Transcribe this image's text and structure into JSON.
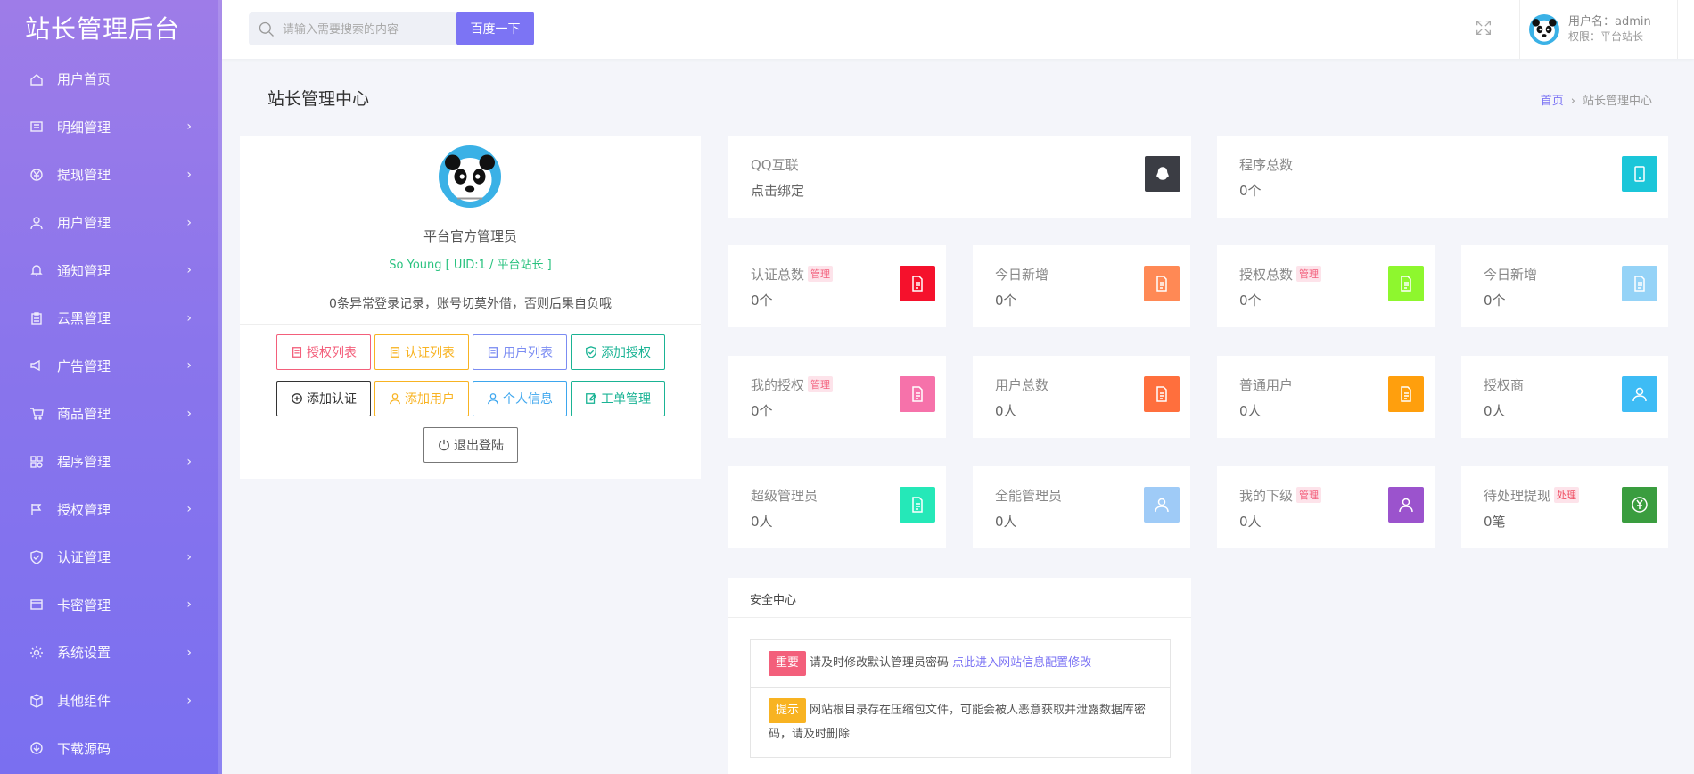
{
  "brand": "站长管理后台",
  "nav": [
    {
      "label": "用户首页",
      "icon": "home-icon",
      "chev": false
    },
    {
      "label": "明细管理",
      "icon": "list-icon",
      "chev": true
    },
    {
      "label": "提现管理",
      "icon": "yen-icon",
      "chev": true
    },
    {
      "label": "用户管理",
      "icon": "user-icon",
      "chev": true
    },
    {
      "label": "通知管理",
      "icon": "bell-icon",
      "chev": true
    },
    {
      "label": "云黑管理",
      "icon": "clipboard-icon",
      "chev": true
    },
    {
      "label": "广告管理",
      "icon": "megaphone-icon",
      "chev": true
    },
    {
      "label": "商品管理",
      "icon": "cart-icon",
      "chev": true
    },
    {
      "label": "程序管理",
      "icon": "apps-icon",
      "chev": true
    },
    {
      "label": "授权管理",
      "icon": "flag-icon",
      "chev": true
    },
    {
      "label": "认证管理",
      "icon": "shield-icon",
      "chev": true
    },
    {
      "label": "卡密管理",
      "icon": "card-icon",
      "chev": true
    },
    {
      "label": "系统设置",
      "icon": "gear-icon",
      "chev": true
    },
    {
      "label": "其他组件",
      "icon": "box-icon",
      "chev": true
    },
    {
      "label": "下载源码",
      "icon": "download-icon",
      "chev": false
    }
  ],
  "chev": "›",
  "search": {
    "placeholder": "请输入需要搜索的内容",
    "button": "百度一下"
  },
  "user": {
    "name": "用户名：admin",
    "role": "权限：平台站长"
  },
  "page_title": "站长管理中心",
  "breadcrumb": {
    "home": "首页",
    "sep": "›",
    "current": "站长管理中心"
  },
  "profile": {
    "name": "平台官方管理员",
    "uid": "So Young [ UID:1 / 平台站长 ]",
    "notice": "0条异常登录记录，账号切莫外借，否则后果自负哦",
    "buttons_row1": [
      "授权列表",
      "认证列表",
      "用户列表",
      "添加授权"
    ],
    "buttons_row2": [
      "添加认证",
      "添加用户",
      "个人信息",
      "工单管理"
    ],
    "logout": "退出登陆"
  },
  "stats": {
    "qq": {
      "title": "QQ互联",
      "value": "点击绑定"
    },
    "programs": {
      "title": "程序总数",
      "value": "0个"
    },
    "certs": {
      "title": "认证总数",
      "badge": "管理",
      "value": "0个"
    },
    "today_new_a": {
      "title": "今日新增",
      "value": "0个"
    },
    "auths": {
      "title": "授权总数",
      "badge": "管理",
      "value": "0个"
    },
    "today_new_b": {
      "title": "今日新增",
      "value": "0个"
    },
    "my_auth": {
      "title": "我的授权",
      "badge": "管理",
      "value": "0个"
    },
    "users": {
      "title": "用户总数",
      "value": "0人"
    },
    "normal_users": {
      "title": "普通用户",
      "value": "0人"
    },
    "agents": {
      "title": "授权商",
      "value": "0人"
    },
    "super_admin": {
      "title": "超级管理员",
      "value": "0人"
    },
    "all_admin": {
      "title": "全能管理员",
      "value": "0人"
    },
    "my_sub": {
      "title": "我的下级",
      "badge": "管理",
      "value": "0人"
    },
    "pending_withdraw": {
      "title": "待处理提现",
      "badge": "处理",
      "value": "0笔"
    }
  },
  "security": {
    "title": "安全中心",
    "row1": {
      "tag": "重要",
      "text": "请及时修改默认管理员密码 ",
      "link": "点此进入网站信息配置修改"
    },
    "row2": {
      "tag": "提示",
      "text": "网站根目录存在压缩包文件，可能会被人恶意获取并泄露数据库密码，请及时删除"
    }
  },
  "colors": {
    "accent": "#7c74f4",
    "qq_icon": "#3b3d44",
    "programs_icon": "#1bc6d9",
    "certs_icon": "#f5112c",
    "today_a_icon": "#ff8955",
    "auths_icon": "#8ef72e",
    "today_b_icon": "#95d3f7",
    "my_auth_icon": "#f672aa",
    "users_icon": "#ff6f3d",
    "normal_icon": "#ff9f0d",
    "agents_icon": "#3ebcf5",
    "super_icon": "#25e8b8",
    "all_admin_icon": "#9fcbf7",
    "my_sub_icon": "#9b53cd",
    "withdraw_icon": "#3a9d3f"
  }
}
